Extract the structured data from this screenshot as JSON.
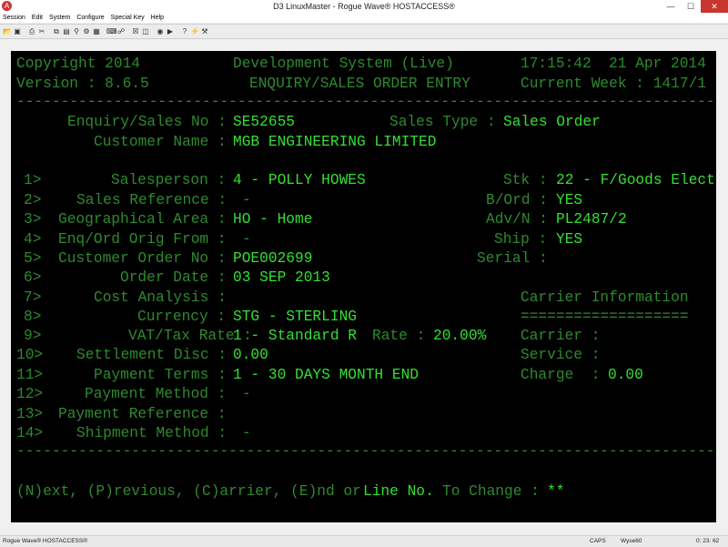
{
  "window": {
    "title": "D3 LinuxMaster - Rogue Wave® HOSTACCESS®",
    "app_icon": "A"
  },
  "menu": [
    "Session",
    "Edit",
    "System",
    "Configure",
    "Special Key",
    "Help"
  ],
  "toolbar_icons": [
    "open-icon",
    "save-icon",
    "print-icon",
    "cut-icon",
    "copy-icon",
    "paste-icon",
    "find-icon",
    "settings-icon",
    "macro-icon",
    "keyboard-icon",
    "connect-icon",
    "disconnect-icon",
    "capture-icon",
    "record-icon",
    "play-icon",
    "help-icon",
    "lightning-icon",
    "tools-icon"
  ],
  "terminal": {
    "copyright": "Copyright 2014",
    "system": "Development System (Live)",
    "time": "17:15:42",
    "date": "21 Apr 2014",
    "version": "Version : 8.6.5",
    "screen_title": "ENQUIRY/SALES ORDER ENTRY",
    "current_week": "Current Week : 1417/1",
    "separator": "--------------------------------------------------------------------------------",
    "enquiry_no_label": "Enquiry/Sales No :",
    "enquiry_no": "SE52655",
    "sales_type_label": "Sales Type :",
    "sales_type": "Sales Order",
    "customer_name_label": "Customer Name :",
    "customer_name": "MGB ENGINEERING LIMITED",
    "fields": [
      {
        "num": "1>",
        "label": "Salesperson :",
        "value": "4 - POLLY HOWES"
      },
      {
        "num": "2>",
        "label": "Sales Reference :",
        "value": "-"
      },
      {
        "num": "3>",
        "label": "Geographical Area :",
        "value": "HO - Home"
      },
      {
        "num": "4>",
        "label": "Enq/Ord Orig From :",
        "value": "-"
      },
      {
        "num": "5>",
        "label": "Customer Order No :",
        "value": "POE002699"
      },
      {
        "num": "6>",
        "label": "Order Date :",
        "value": "03 SEP 2013"
      },
      {
        "num": "7>",
        "label": "Cost Analysis :",
        "value": ""
      },
      {
        "num": "8>",
        "label": "Currency :",
        "value": "STG - STERLING"
      },
      {
        "num": "9>",
        "label": "VAT/Tax Rate :",
        "value": "1 - Standard R"
      },
      {
        "num": "10>",
        "label": "Settlement Disc :",
        "value": "0.00"
      },
      {
        "num": "11>",
        "label": "Payment Terms :",
        "value": "1 - 30 DAYS MONTH END"
      },
      {
        "num": "12>",
        "label": "Payment Method :",
        "value": "-"
      },
      {
        "num": "13>",
        "label": "Payment Reference :",
        "value": ""
      },
      {
        "num": "14>",
        "label": "Shipment Method :",
        "value": "-"
      }
    ],
    "rate_label": "Rate :",
    "rate_value": "20.00%",
    "right_fields": [
      {
        "label": "Stk :",
        "value": "22 - F/Goods Elect"
      },
      {
        "label": "B/Ord :",
        "value": "YES"
      },
      {
        "label": "Adv/N :",
        "value": "PL2487/2"
      },
      {
        "label": "Ship :",
        "value": "YES"
      },
      {
        "label": "Serial :",
        "value": ""
      }
    ],
    "carrier_title": "Carrier Information",
    "carrier_underline": "===================",
    "carrier_label": "Carrier :",
    "service_label": "Service :",
    "charge_label": "Charge  :",
    "charge_value": "0.00",
    "prompt": "(N)ext, (P)revious, (C)arrier, (E)nd or",
    "prompt_hi": "Line No.",
    "prompt_change": "To Change :",
    "prompt_input": "**"
  },
  "status": {
    "left": "Rogue Wave® HOSTACCESS®",
    "caps": "CAPS",
    "terminal_type": "Wyse60",
    "cursor": "0: 23: 62"
  }
}
